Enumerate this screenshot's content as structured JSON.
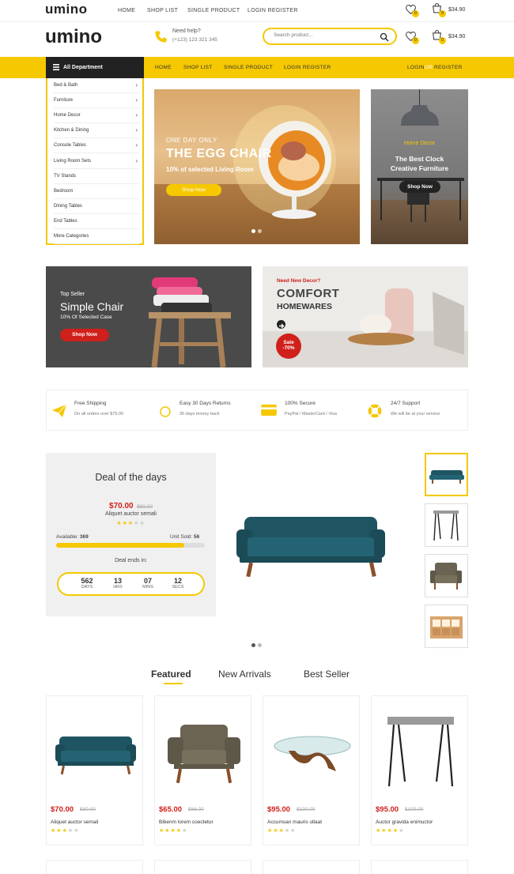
{
  "topbar": {
    "logo": "umino",
    "nav": [
      "HOME",
      "SHOP LIST",
      "SINGLE PRODUCT",
      "LOGIN REGISTER"
    ],
    "wishlist_count": "0",
    "cart_count": "0",
    "cart_total": "$34.90"
  },
  "header": {
    "logo": "umino",
    "help_label": "Need help?",
    "help_phone": "(+123) 123 321 345",
    "search_placeholder": "Search product...",
    "wishlist_count": "0",
    "cart_count": "0",
    "cart_total": "$34.90"
  },
  "navbar": {
    "all_department": "All Department",
    "items": [
      "HOME",
      "SHOP LIST",
      "SINGLE PRODUCT",
      "LOGIN REGISTER"
    ],
    "login": "LOGIN",
    "or": "OR",
    "register": "REGISTER"
  },
  "departments": [
    {
      "label": "Bed & Bath",
      "has_sub": true
    },
    {
      "label": "Furniture",
      "has_sub": true
    },
    {
      "label": "Home Decor",
      "has_sub": true
    },
    {
      "label": "Kitchen & Dining",
      "has_sub": true
    },
    {
      "label": "Console Tables",
      "has_sub": true
    },
    {
      "label": "Living Room Sets",
      "has_sub": true
    },
    {
      "label": "TV Stands",
      "has_sub": false
    },
    {
      "label": "Bedroom",
      "has_sub": false
    },
    {
      "label": "Dining Tables",
      "has_sub": false
    },
    {
      "label": "End Tables",
      "has_sub": false
    },
    {
      "label": "More Categories",
      "has_sub": false
    }
  ],
  "slider": {
    "kicker": "ONE DAY ONLY",
    "title": "THE EGG CHAIR",
    "subtitle": "10% of selected Living Room",
    "button": "Shop Now"
  },
  "side_banner": {
    "kicker": "Home Decor",
    "title_line1": "The Best Clock",
    "title_line2": "Creative Furniture",
    "button": "Shop Now"
  },
  "banner_left": {
    "kicker": "Top Seller",
    "title": "Simple Chair",
    "subtitle": "10% Of Selected Case",
    "button": "Shop Now"
  },
  "banner_right": {
    "kicker": "Need New Decor?",
    "title1": "COMFORT",
    "title2": "HOMEWARES",
    "sale": "Sale",
    "sale_pct": "-70%"
  },
  "features": [
    {
      "title": "Free Shipping",
      "sub": "On all orders over $75.00",
      "icon": "paper-plane-icon"
    },
    {
      "title": "Easy 30 Days Returns",
      "sub": "30 days money back",
      "icon": "refresh-icon"
    },
    {
      "title": "100% Secure",
      "sub": "PayPal / MasterCard / Visa",
      "icon": "credit-card-icon"
    },
    {
      "title": "24/7 Support",
      "sub": "We will be at your service",
      "icon": "lifebuoy-icon"
    }
  ],
  "deal": {
    "title": "Deal of the days",
    "price": "$70.00",
    "old_price": "$80.00",
    "name": "Aliquet auctor semali",
    "rating": 3,
    "available_label": "Available:",
    "available": "369",
    "sold_label": "Unit Sold:",
    "sold": "56",
    "sold_fraction": 0.86,
    "ends_label": "Deal ends in:",
    "countdown": [
      {
        "value": "562",
        "unit": "DAYS"
      },
      {
        "value": "13",
        "unit": "HRS"
      },
      {
        "value": "07",
        "unit": "MINS"
      },
      {
        "value": "12",
        "unit": "SECS"
      }
    ]
  },
  "tabs": [
    "Featured",
    "New Arrivals",
    "Best Seller"
  ],
  "products": [
    {
      "price": "$70.00",
      "old": "$80.00",
      "name": "Aliquet auctor semali",
      "rating": 3
    },
    {
      "price": "$65.00",
      "old": "$66.00",
      "name": "Bibenm lorem coectetur",
      "rating": 4
    },
    {
      "price": "$95.00",
      "old": "$100.00",
      "name": "Accumsan mauris ullaat",
      "rating": 3
    },
    {
      "price": "$95.00",
      "old": "$100.00",
      "name": "Auctor gravida enimuctor",
      "rating": 4
    }
  ],
  "colors": {
    "accent": "#f5c800",
    "dark": "#222222",
    "sale": "#d0201b"
  }
}
